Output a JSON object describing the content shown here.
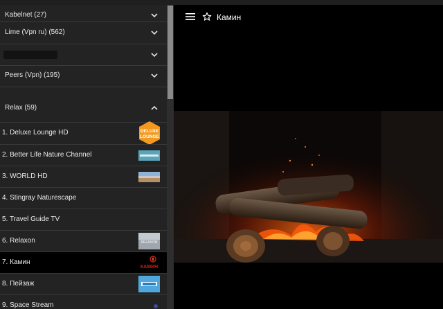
{
  "groups": [
    {
      "label": "Kabelnet (27)",
      "expanded": false
    },
    {
      "label": "Lime (Vpn ru) (562)",
      "expanded": false
    },
    {
      "label": "",
      "expanded": false
    },
    {
      "label": "Peers (Vpn) (195)",
      "expanded": false
    },
    {
      "label": "Relax (59)",
      "expanded": true
    }
  ],
  "channels": [
    {
      "label": "1. Deluxe Lounge HD",
      "logo": "deluxe-lounge-logo",
      "logo_text": "DELUXE\nLOUNGE"
    },
    {
      "label": "2. Better Life Nature Channel",
      "logo": "better-life-logo"
    },
    {
      "label": "3. WORLD HD",
      "logo": "world-hd-logo"
    },
    {
      "label": "4. Stingray Naturescape",
      "logo": ""
    },
    {
      "label": "5. Travel Guide TV",
      "logo": ""
    },
    {
      "label": "6. Relaxon",
      "logo": "relaxon-logo",
      "logo_text": "RELAXON"
    },
    {
      "label": "7. Камин",
      "logo": "kamin-logo",
      "logo_text": "КАМИН",
      "selected": true
    },
    {
      "label": "8. Пейзаж",
      "logo": "peyzazh-logo"
    },
    {
      "label": "9. Space Stream",
      "logo": "space-stream-logo"
    }
  ],
  "header": {
    "title": "Камин",
    "menu_icon": "hamburger-menu-icon",
    "favorite_icon": "star-outline-icon"
  },
  "colors": {
    "sidebar_bg": "#232323",
    "selected_bg": "#000000",
    "text": "#eaeaea",
    "deluxe_orange": "#f39a1e",
    "kamin_red": "#c8201a"
  }
}
